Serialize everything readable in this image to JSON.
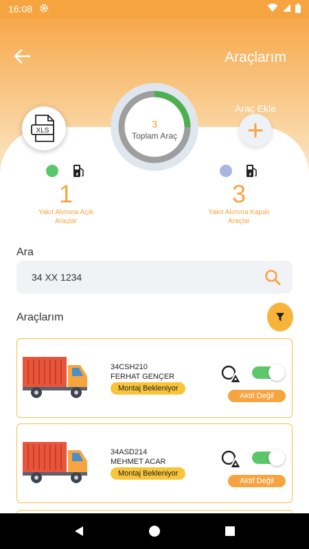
{
  "status_bar": {
    "time": "16:08",
    "icons": [
      "settings-gear-icon",
      "wifi-icon",
      "signal-icon",
      "battery-icon"
    ]
  },
  "header": {
    "title": "Araçlarım",
    "back_icon": "arrow-left-icon"
  },
  "xls_button": {
    "label": "XLS",
    "icon": "xls-file-icon"
  },
  "gauge": {
    "count": "3",
    "label": "Toplam Araç",
    "green_fraction": 0.25
  },
  "add_vehicle": {
    "label": "Araç Ekle",
    "icon": "plus-icon"
  },
  "stats": {
    "open": {
      "count": "1",
      "caption_line1": "Yakıt Alımına Açık",
      "caption_line2": "Araçlar",
      "dot_color": "#5cc76a",
      "icon": "fuel-pump-icon"
    },
    "closed": {
      "count": "3",
      "caption_line1": "Yakıt Alımına Kapalı",
      "caption_line2": "Araçlar",
      "dot_color": "#a9b6e0",
      "icon": "fuel-pump-icon"
    }
  },
  "search": {
    "label": "Ara",
    "value": "34 XX 1234",
    "icon": "search-icon"
  },
  "list": {
    "label": "Araçlarım",
    "filter_icon": "filter-icon"
  },
  "vehicles": [
    {
      "plate": "34CSH210",
      "owner": "FERHAT GENÇER",
      "badge": "Montaj Bekleniyor",
      "toggle_on": true,
      "status": "Aktif Değil"
    },
    {
      "plate": "34ASD214",
      "owner": "MEHMET ACAR",
      "badge": "Montaj Bekleniyor",
      "toggle_on": true,
      "status": "Aktif Değil"
    }
  ],
  "colors": {
    "accent": "#f6a43f",
    "badge": "#f8c53a",
    "toggle": "#5cc76a",
    "gauge_green": "#4caf50",
    "gauge_gray": "#9e9e9e"
  },
  "nav_bar": {
    "icons": [
      "back-triangle-icon",
      "home-circle-icon",
      "recents-square-icon"
    ]
  }
}
